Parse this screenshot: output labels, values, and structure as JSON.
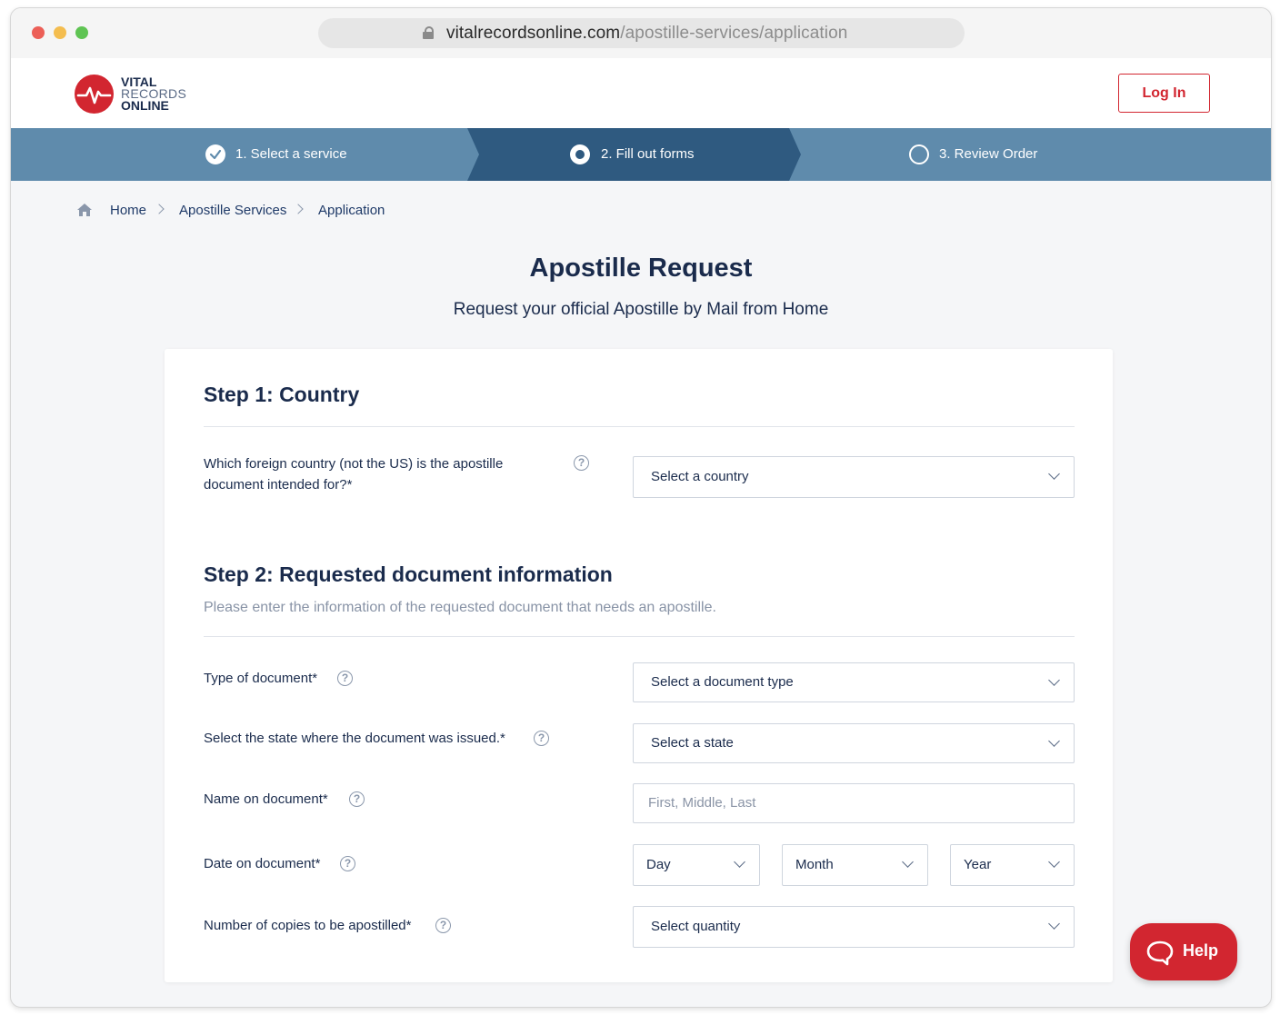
{
  "browser": {
    "url_domain": "vitalrecordsonline.com",
    "url_path": "/apostille-services/application"
  },
  "brand": {
    "logo_line1": "VITAL",
    "logo_line2": "RECORDS",
    "logo_line3": "ONLINE",
    "accent_color": "#d22630",
    "navy_color": "#1a2b4c",
    "steps_bar_color": "#5f8bac",
    "steps_active_color": "#2f5a80"
  },
  "header": {
    "login_label": "Log In"
  },
  "steps": [
    {
      "label": "1. Select a service",
      "state": "completed"
    },
    {
      "label": "2. Fill out forms",
      "state": "active"
    },
    {
      "label": "3. Review Order",
      "state": "pending"
    }
  ],
  "breadcrumb": {
    "items": [
      "Home",
      "Apostille Services",
      "Application"
    ]
  },
  "page": {
    "title": "Apostille Request",
    "subtitle": "Request your official Apostille by Mail from Home"
  },
  "form": {
    "step1": {
      "title": "Step 1: Country",
      "country_label": "Which foreign country (not the US) is the apostille document intended for?*",
      "country_value": "Select a country"
    },
    "step2": {
      "title": "Step  2: Requested document information",
      "subtitle": "Please enter the information of the requested document that needs an apostille.",
      "doc_type_label": "Type of document*",
      "doc_type_value": "Select a document type",
      "state_label": "Select the state where the document was issued.*",
      "state_value": "Select a state",
      "name_label": "Name on document*",
      "name_placeholder": "First, Middle, Last",
      "date_label": "Date on document*",
      "day_value": "Day",
      "month_value": "Month",
      "year_value": "Year",
      "copies_label": "Number of copies to be apostilled*",
      "copies_value": "Select quantity"
    }
  },
  "help_button": {
    "label": "Help"
  },
  "icons": {
    "help": "?"
  }
}
